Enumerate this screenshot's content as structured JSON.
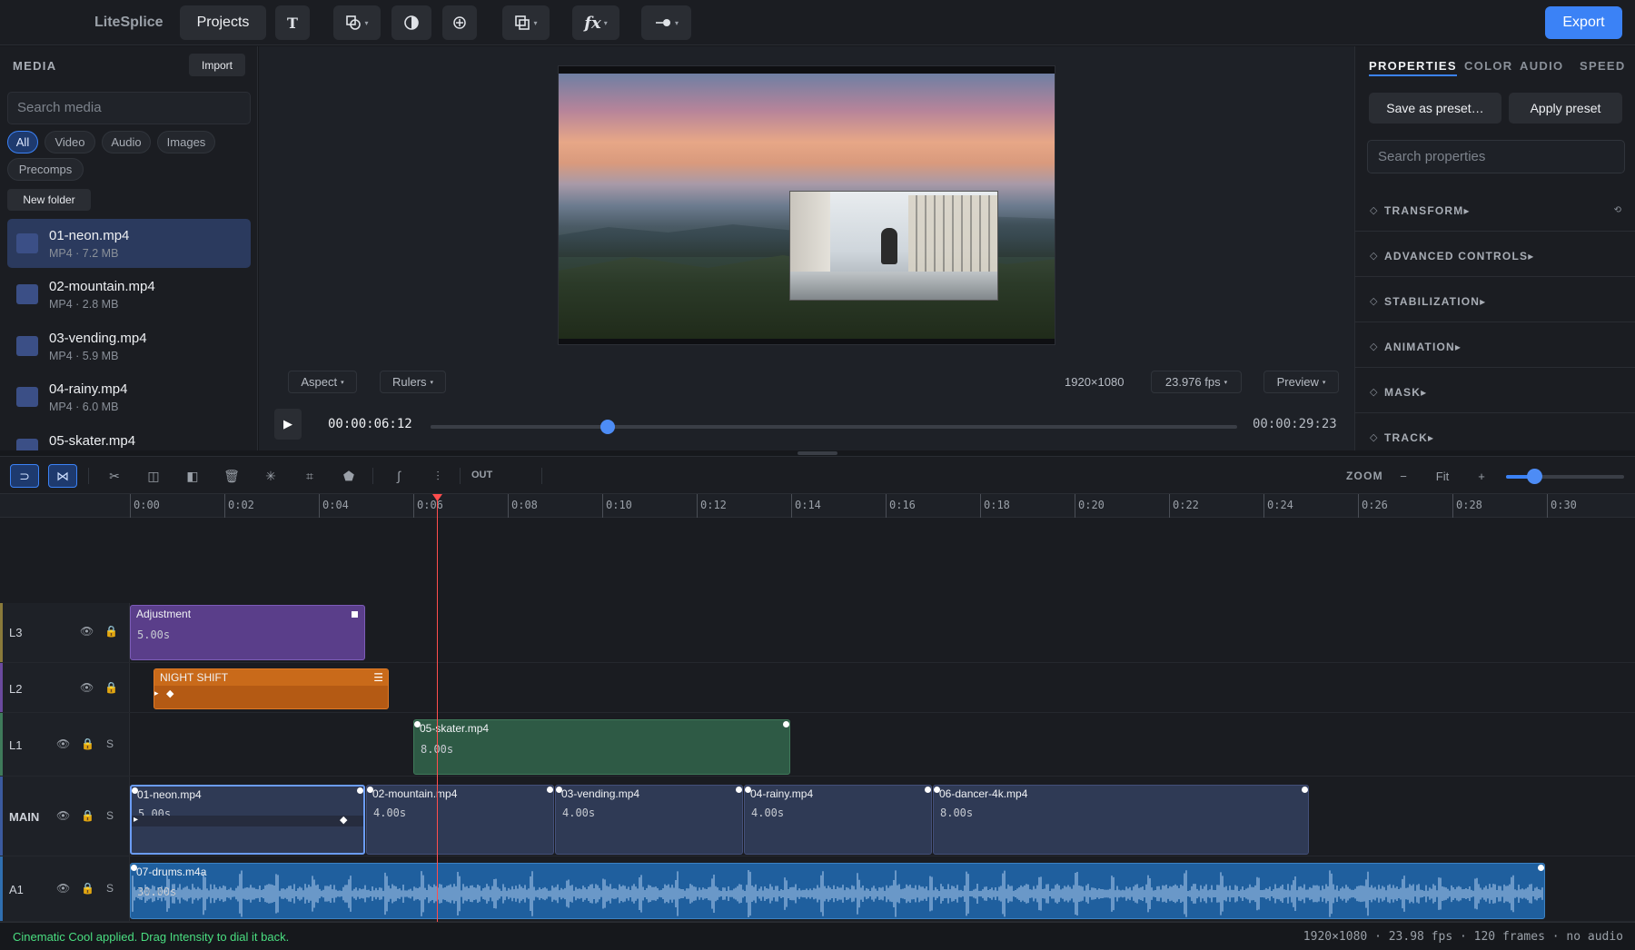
{
  "app": {
    "name": "LiteSplice",
    "projects_label": "Projects",
    "export_label": "Export"
  },
  "toolbar": {
    "text_tool": "T",
    "shape_tool_icon": "shapes-icon",
    "contrast_icon": "contrast-icon",
    "add_icon": "crosshair-plus-icon",
    "overlay_icon": "overlay-icon",
    "fx_label": "fx",
    "toggle_icon": "toggle-icon"
  },
  "media": {
    "title": "MEDIA",
    "import_label": "Import",
    "search_placeholder": "Search media",
    "filters": [
      "All",
      "Video",
      "Audio",
      "Images",
      "Precomps"
    ],
    "new_folder_label": "New folder",
    "items": [
      {
        "name": "01-neon.mp4",
        "meta": "MP4 · 7.2 MB"
      },
      {
        "name": "02-mountain.mp4",
        "meta": "MP4 · 2.8 MB"
      },
      {
        "name": "03-vending.mp4",
        "meta": "MP4 · 5.9 MB"
      },
      {
        "name": "04-rainy.mp4",
        "meta": "MP4 · 6.0 MB"
      },
      {
        "name": "05-skater.mp4",
        "meta": ""
      }
    ]
  },
  "viewer": {
    "aspect_label": "Aspect",
    "rulers_label": "Rulers",
    "resolution": "1920×1080",
    "fps_label": "23.976 fps",
    "preview_label": "Preview",
    "timecode": "00:00:06:12",
    "duration": "00:00:29:23",
    "playback_progress": 0.22
  },
  "properties": {
    "tabs": [
      "PROPERTIES",
      "COLOR",
      "AUDIO",
      "SPEED"
    ],
    "active_tab": "PROPERTIES",
    "save_preset_label": "Save as preset…",
    "apply_preset_label": "Apply preset",
    "search_placeholder": "Search properties",
    "sections": [
      "TRANSFORM",
      "ADVANCED CONTROLS",
      "STABILIZATION",
      "ANIMATION",
      "MASK",
      "TRACK"
    ]
  },
  "timeline": {
    "out_label": "OUT",
    "zoom_label": "ZOOM",
    "zoom_minus": "−",
    "zoom_fit": "Fit",
    "zoom_plus": "+",
    "zoom_level": 0.24,
    "ruler_ticks": [
      "0:00",
      "0:02",
      "0:04",
      "0:06",
      "0:08",
      "0:10",
      "0:12",
      "0:14",
      "0:16",
      "0:18",
      "0:20",
      "0:22",
      "0:24",
      "0:26",
      "0:28",
      "0:30"
    ],
    "tracks": [
      {
        "name": "L3",
        "color": "#6b4a9e",
        "has_solo": false
      },
      {
        "name": "L2",
        "color": "#6b4a9e",
        "has_solo": false
      },
      {
        "name": "L1",
        "color": "#3f7a5a",
        "has_solo": true
      },
      {
        "name": "MAIN",
        "color": "#3b5a9e",
        "has_solo": true
      },
      {
        "name": "A1",
        "color": "#2f6fb0",
        "has_solo": true
      }
    ],
    "solo_label": "S",
    "clips": {
      "adjustment": {
        "name": "Adjustment",
        "duration": "5.00s"
      },
      "night_shift": {
        "name": "NIGHT SHIFT"
      },
      "skater": {
        "name": "05-skater.mp4",
        "duration": "8.00s"
      },
      "main": [
        {
          "name": "01-neon.mp4",
          "duration": "5.00s"
        },
        {
          "name": "02-mountain.mp4",
          "duration": "4.00s"
        },
        {
          "name": "03-vending.mp4",
          "duration": "4.00s"
        },
        {
          "name": "04-rainy.mp4",
          "duration": "4.00s"
        },
        {
          "name": "06-dancer-4k.mp4",
          "duration": "8.00s"
        }
      ],
      "audio": {
        "name": "07-drums.m4a",
        "duration": "30.00s"
      }
    }
  },
  "status": {
    "message": "Cinematic Cool applied. Drag Intensity to dial it back.",
    "info": "1920×1080 · 23.98 fps · 120 frames · no audio"
  }
}
